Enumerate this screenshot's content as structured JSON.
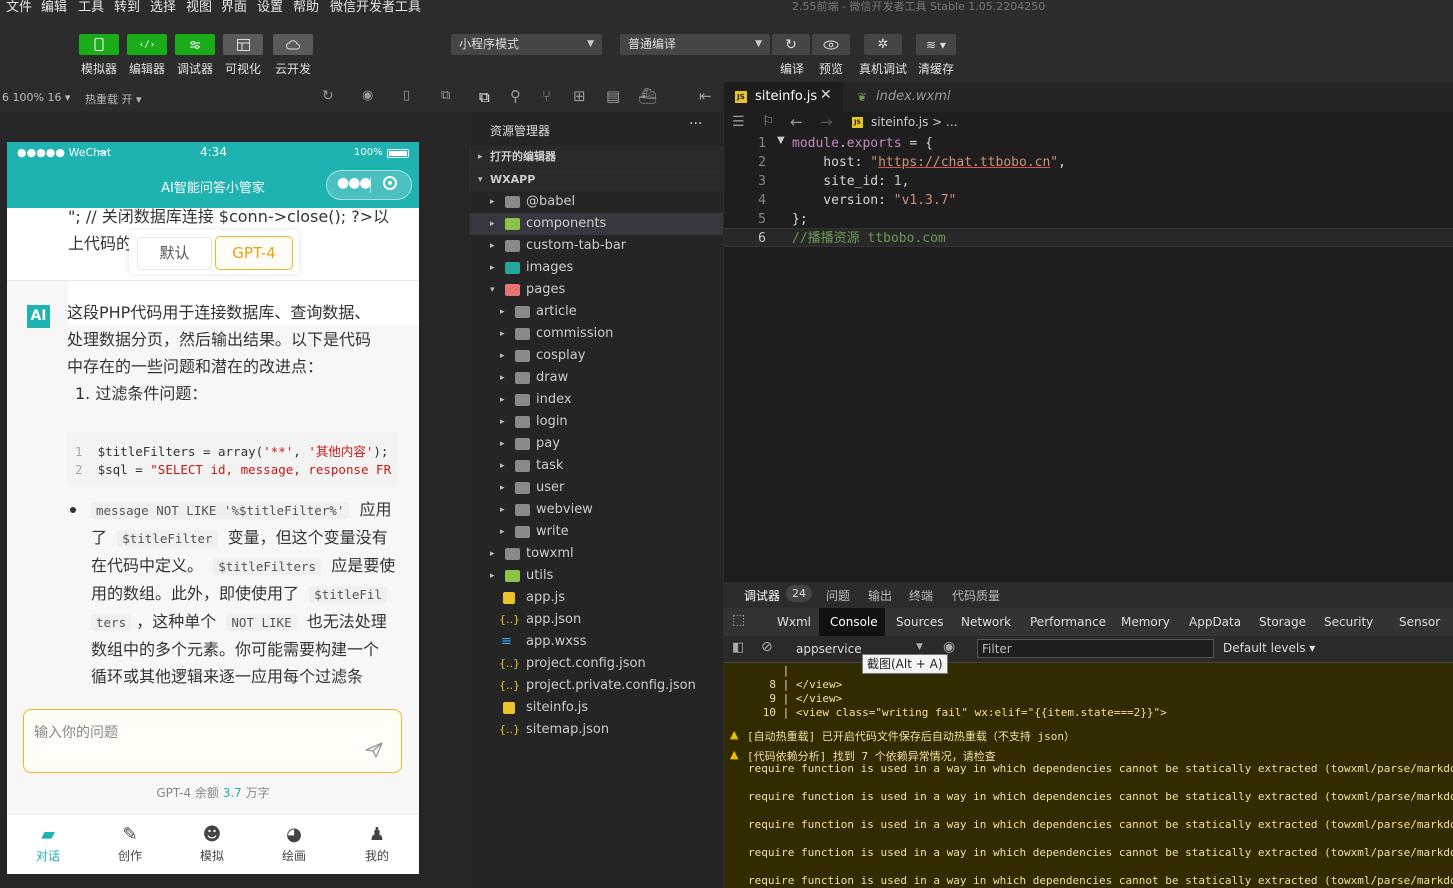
{
  "menu": [
    "文件",
    "编辑",
    "工具",
    "转到",
    "选择",
    "视图",
    "界面",
    "设置",
    "帮助",
    "微信开发者工具"
  ],
  "window_title": "2.55前端 - 微信开发者工具 Stable 1.05.2204250",
  "toolbar": {
    "left": [
      "模拟器",
      "编辑器",
      "调试器",
      "可视化",
      "云开发"
    ],
    "mode_select": "小程序模式",
    "compile_select": "普通编译",
    "right": [
      "编译",
      "预览",
      "真机调试",
      "清缓存"
    ]
  },
  "simulator_bar": {
    "zoom": "6 100% 16",
    "hot_reload": "热重载 开"
  },
  "phone": {
    "status_left": "●●●●● WeChat",
    "time": "4:34",
    "battery": "100%",
    "nav_title": "AI智能问答小管家",
    "top_text_1": "\"; // 关闭数据库连接 $conn->close(); ?>以",
    "top_text_2": "上代码的",
    "model_default": "默认",
    "model_gpt4": "GPT-4",
    "ai_badge": "AI",
    "answer_lines": [
      "这段PHP代码用于连接数据库、查询数据、",
      "处理数据分页，然后输出结果。以下是代码",
      "中存在的一些问题和潜在的改进点："
    ],
    "list_item": "1. 过滤条件问题：",
    "code_block": [
      {
        "n": "1",
        "pre": "$titleFilters = array(",
        "s1": "'**'",
        "mid": ", ",
        "s2": "'其他内容'",
        "post": ");"
      },
      {
        "n": "2",
        "pre": "$sql = ",
        "s1": "\"SELECT id, message, response FR",
        "mid": "",
        "s2": "",
        "post": ""
      }
    ],
    "bullet": {
      "c1": "message NOT LIKE '%$titleFilter%'",
      "t1": "应用",
      "t2": "了",
      "c2": "$titleFilter",
      "t3": "变量，但这个变量没有",
      "t4": "在代码中定义。",
      "c3": "$titleFilters",
      "t5": "应是要使",
      "t6": "用的数组。此外，即使使用了",
      "c4": "$titleFil",
      "c5": "ters",
      "t7": "，这种单个",
      "c6": "NOT LIKE",
      "t8": "也无法处理",
      "t9": "数组中的多个元素。你可能需要构建一个",
      "t10": "循环或其他逻辑来逐一应用每个过滤条"
    },
    "input_placeholder": "输入你的问题",
    "quota_prefix": "GPT-4 余额",
    "quota_value": "3.7",
    "quota_suffix": "万字",
    "tabs": [
      "对话",
      "创作",
      "模拟",
      "绘画",
      "我的"
    ]
  },
  "explorer": {
    "title": "资源管理器",
    "open_editors": "打开的编辑器",
    "root": "WXAPP",
    "items": [
      {
        "name": "@babel",
        "depth": 1,
        "kind": "folder",
        "arrow": "▸"
      },
      {
        "name": "components",
        "depth": 1,
        "kind": "folder-green",
        "arrow": "▸"
      },
      {
        "name": "custom-tab-bar",
        "depth": 1,
        "kind": "folder",
        "arrow": "▸"
      },
      {
        "name": "images",
        "depth": 1,
        "kind": "folder-teal",
        "arrow": "▸"
      },
      {
        "name": "pages",
        "depth": 1,
        "kind": "folder-red",
        "arrow": "▾"
      },
      {
        "name": "article",
        "depth": 2,
        "kind": "folder",
        "arrow": "▸"
      },
      {
        "name": "commission",
        "depth": 2,
        "kind": "folder",
        "arrow": "▸"
      },
      {
        "name": "cosplay",
        "depth": 2,
        "kind": "folder",
        "arrow": "▸"
      },
      {
        "name": "draw",
        "depth": 2,
        "kind": "folder",
        "arrow": "▸"
      },
      {
        "name": "index",
        "depth": 2,
        "kind": "folder",
        "arrow": "▸"
      },
      {
        "name": "login",
        "depth": 2,
        "kind": "folder",
        "arrow": "▸"
      },
      {
        "name": "pay",
        "depth": 2,
        "kind": "folder",
        "arrow": "▸"
      },
      {
        "name": "task",
        "depth": 2,
        "kind": "folder",
        "arrow": "▸"
      },
      {
        "name": "user",
        "depth": 2,
        "kind": "folder",
        "arrow": "▸"
      },
      {
        "name": "webview",
        "depth": 2,
        "kind": "folder",
        "arrow": "▸"
      },
      {
        "name": "write",
        "depth": 2,
        "kind": "folder",
        "arrow": "▸"
      },
      {
        "name": "towxml",
        "depth": 1,
        "kind": "folder",
        "arrow": "▸"
      },
      {
        "name": "utils",
        "depth": 1,
        "kind": "folder-green",
        "arrow": "▸"
      },
      {
        "name": "app.js",
        "depth": 1,
        "kind": "js",
        "arrow": ""
      },
      {
        "name": "app.json",
        "depth": 1,
        "kind": "json",
        "arrow": ""
      },
      {
        "name": "app.wxss",
        "depth": 1,
        "kind": "css",
        "arrow": ""
      },
      {
        "name": "project.config.json",
        "depth": 1,
        "kind": "json",
        "arrow": ""
      },
      {
        "name": "project.private.config.json",
        "depth": 1,
        "kind": "json",
        "arrow": ""
      },
      {
        "name": "siteinfo.js",
        "depth": 1,
        "kind": "js",
        "arrow": ""
      },
      {
        "name": "sitemap.json",
        "depth": 1,
        "kind": "json",
        "arrow": ""
      }
    ]
  },
  "editor": {
    "tabs": [
      {
        "name": "siteinfo.js",
        "active": true
      },
      {
        "name": "index.wxml",
        "active": false
      }
    ],
    "breadcrumb": "siteinfo.js > ...",
    "lines": [
      {
        "n": "1",
        "parts": [
          [
            "kw",
            "module"
          ],
          [
            "op",
            "."
          ],
          [
            "kw",
            "exports"
          ],
          [
            "op",
            " = {"
          ]
        ]
      },
      {
        "n": "2",
        "parts": [
          [
            "op",
            "    host: "
          ],
          [
            "str",
            "\""
          ],
          [
            "url",
            "https://chat.ttbobo.cn"
          ],
          [
            "str",
            "\""
          ],
          [
            "op",
            ","
          ]
        ]
      },
      {
        "n": "3",
        "parts": [
          [
            "op",
            "    site_id: "
          ],
          [
            "num",
            "1"
          ],
          [
            "op",
            ","
          ]
        ]
      },
      {
        "n": "4",
        "parts": [
          [
            "op",
            "    version: "
          ],
          [
            "str",
            "\"v1.3.7\""
          ]
        ]
      },
      {
        "n": "5",
        "parts": [
          [
            "op",
            "};"
          ]
        ]
      },
      {
        "n": "6",
        "parts": [
          [
            "cmt",
            "//播播资源 ttbobo.com"
          ]
        ]
      }
    ]
  },
  "devtools": {
    "top_tabs": [
      "调试器",
      "问题",
      "输出",
      "终端",
      "代码质量"
    ],
    "badge": "24",
    "tabs": [
      "Wxml",
      "Console",
      "Sources",
      "Network",
      "Performance",
      "Memory",
      "AppData",
      "Storage",
      "Security",
      "Sensor"
    ],
    "context": "appservice",
    "filter_placeholder": "Filter",
    "levels": "Default levels",
    "tooltip": "截图(Alt + A)",
    "code_lines": [
      {
        "n": "",
        "t": "|"
      },
      {
        "n": "8",
        "t": "|          </view>"
      },
      {
        "n": "9",
        "t": "|      </view>"
      },
      {
        "n": "10",
        "t": "|      <view class=\"writing fail\" wx:elif=\"{{item.state===2}}\">"
      }
    ],
    "warn1": "[自动热重载] 已开启代码文件保存后自动热重载（不支持 json）",
    "warn2": "[代码依赖分析] 找到 7 个依赖异常情况，请检查",
    "require_msg": "require function is used in a way in which dependencies cannot be statically extracted (towxml/parse/markdo"
  },
  "colors": {
    "accent_green": "#1aad19",
    "teal": "#1eb2b0",
    "gold": "#f0b429",
    "warn_bg": "#332b00"
  }
}
